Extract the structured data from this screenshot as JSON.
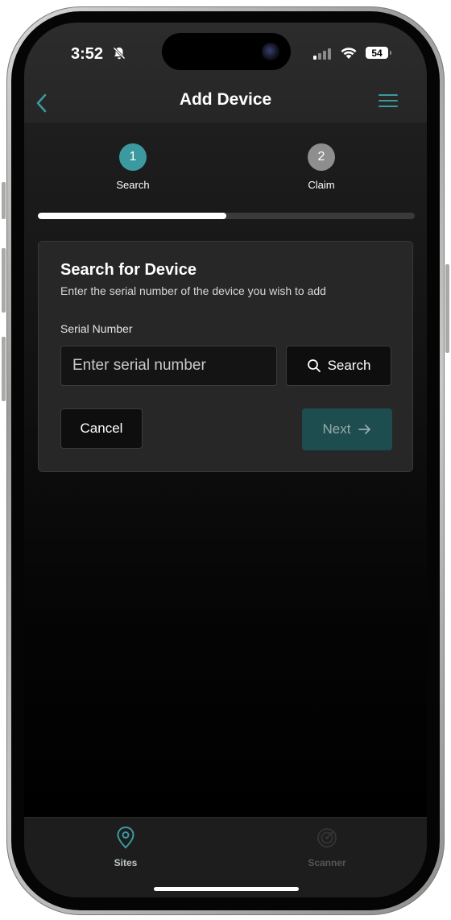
{
  "status_bar": {
    "time": "3:52",
    "battery": "54",
    "bell_icon": "bell-slash-icon",
    "wifi_icon": "wifi-icon",
    "signal_icon": "cellular-signal-icon"
  },
  "header": {
    "title": "Add Device",
    "back_icon": "chevron-left-icon",
    "menu_icon": "hamburger-menu-icon"
  },
  "stepper": {
    "steps": [
      {
        "number": "1",
        "label": "Search",
        "active": true
      },
      {
        "number": "2",
        "label": "Claim",
        "active": false
      }
    ],
    "progress_fraction": 0.5
  },
  "card": {
    "title": "Search for Device",
    "subtitle": "Enter the serial number of the device you wish to add",
    "field_label": "Serial Number",
    "input_placeholder": "Enter serial number",
    "search_label": "Search",
    "cancel_label": "Cancel",
    "next_label": "Next"
  },
  "tabbar": {
    "tabs": [
      {
        "label": "Sites",
        "icon": "map-pin-icon",
        "active": true
      },
      {
        "label": "Scanner",
        "icon": "radar-icon",
        "active": false
      }
    ]
  },
  "colors": {
    "accent": "#3b9aa0",
    "next_button_bg": "#1e4d50",
    "background": "#000000",
    "card_bg": "#272727"
  }
}
